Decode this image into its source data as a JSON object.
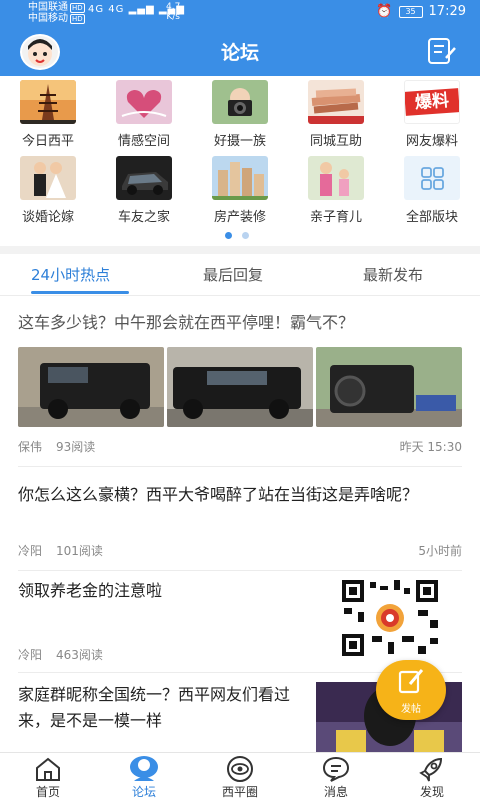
{
  "status_bar": {
    "carrier1": "中国联通",
    "carrier2": "中国移动",
    "hd": "HD",
    "signal": "4G 4G",
    "speed_value": "4.7",
    "speed_unit": "K/s",
    "battery": "35",
    "time": "17:29"
  },
  "header": {
    "title": "论坛"
  },
  "categories": [
    {
      "label": "今日西平",
      "icon": "pagoda-photo"
    },
    {
      "label": "情感空间",
      "icon": "heart-book-photo"
    },
    {
      "label": "好摄一族",
      "icon": "camera-photo"
    },
    {
      "label": "同城互助",
      "icon": "hands-photo"
    },
    {
      "label": "网友爆料",
      "icon": "baoliao-badge"
    },
    {
      "label": "谈婚论嫁",
      "icon": "couple-photo"
    },
    {
      "label": "车友之家",
      "icon": "car-photo"
    },
    {
      "label": "房产装修",
      "icon": "buildings-photo"
    },
    {
      "label": "亲子育儿",
      "icon": "family-photo"
    },
    {
      "label": "全部版块",
      "icon": "grid-icon"
    }
  ],
  "badge_text": "爆料",
  "pager": {
    "pages": 2,
    "current": 1
  },
  "tabs": [
    {
      "label": "24小时热点",
      "active": true
    },
    {
      "label": "最后回复",
      "active": false
    },
    {
      "label": "最新发布",
      "active": false
    }
  ],
  "posts": [
    {
      "title": "这车多少钱？中午那会就在西平停哩！霸气不？",
      "author": "保伟",
      "views": "93阅读",
      "time": "昨天 15:30"
    },
    {
      "title": "你怎么这么豪横？西平大爷喝醉了站在当街这是弄啥呢？",
      "author": "冷阳",
      "views": "101阅读",
      "time": "5小时前"
    },
    {
      "title": "领取养老金的注意啦",
      "author": "冷阳",
      "views": "463阅读",
      "time": ""
    },
    {
      "title": "家庭群昵称全国统一？西平网友们看过来，是不是一模一样",
      "author": "",
      "views": "",
      "time": ""
    }
  ],
  "fab": {
    "label": "发帖"
  },
  "bottom_nav": [
    {
      "label": "首页",
      "icon": "home-icon",
      "active": false
    },
    {
      "label": "论坛",
      "icon": "forum-icon",
      "active": true
    },
    {
      "label": "西平圈",
      "icon": "eye-circle-icon",
      "active": false
    },
    {
      "label": "消息",
      "icon": "message-icon",
      "active": false
    },
    {
      "label": "发现",
      "icon": "rocket-icon",
      "active": false
    }
  ],
  "colors": {
    "primary": "#3a8ee6",
    "active_text": "#2d7fd8",
    "fab": "#f6b318",
    "meta_text": "#888888"
  }
}
